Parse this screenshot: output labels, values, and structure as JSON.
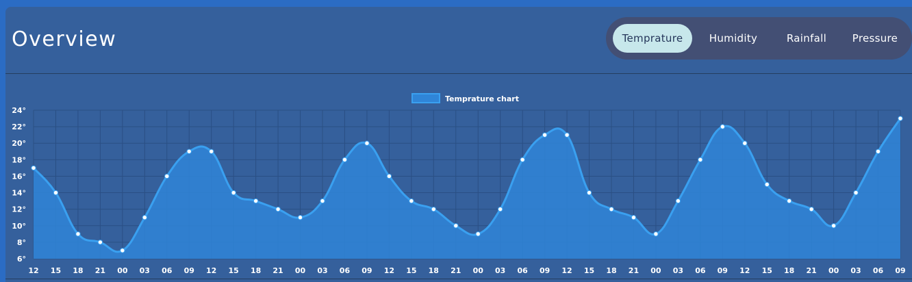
{
  "header": {
    "title": "Overview"
  },
  "tabs": [
    {
      "label": "Temprature",
      "active": true
    },
    {
      "label": "Humidity",
      "active": false
    },
    {
      "label": "Rainfall",
      "active": false
    },
    {
      "label": "Pressure",
      "active": false
    }
  ],
  "colors": {
    "page_bg": "#2b6cc4",
    "panel_bg": "#35609c",
    "tab_group_bg": "#434f74",
    "tab_active_bg": "#c7e7eb",
    "line": "#3aa0f0",
    "fill": "#2f85d8",
    "point": "#ffffff"
  },
  "chart_data": {
    "type": "area",
    "legend": {
      "label": "Temprature chart",
      "position": "top-center"
    },
    "x": [
      "12",
      "15",
      "18",
      "21",
      "00",
      "03",
      "06",
      "09",
      "12",
      "15",
      "18",
      "21",
      "00",
      "03",
      "06",
      "09",
      "12",
      "15",
      "18",
      "21",
      "00",
      "03",
      "06",
      "09",
      "12",
      "15",
      "18",
      "21",
      "00",
      "03",
      "06",
      "09",
      "12",
      "15",
      "18",
      "21",
      "00",
      "03",
      "06",
      "09"
    ],
    "series": [
      {
        "name": "Temprature chart",
        "values": [
          17,
          14,
          9,
          8,
          7,
          11,
          16,
          19,
          19,
          14,
          13,
          12,
          11,
          13,
          18,
          20,
          16,
          13,
          12,
          10,
          9,
          12,
          18,
          21,
          21,
          14,
          12,
          11,
          9,
          13,
          18,
          22,
          20,
          15,
          13,
          12,
          10,
          14,
          19,
          23
        ]
      }
    ],
    "ylim": [
      6,
      24
    ],
    "yticks": [
      "6°",
      "8°",
      "10°",
      "12°",
      "14°",
      "16°",
      "18°",
      "20°",
      "22°",
      "24°"
    ],
    "grid": true
  }
}
